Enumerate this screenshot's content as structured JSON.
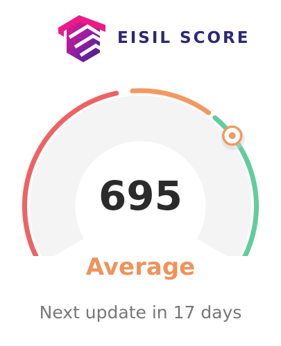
{
  "brand": {
    "name": "EISIL SCORE",
    "logo_icon": "layered-cube-logo-icon",
    "logo_gradient": [
      "#e5157d",
      "#5b1f9f",
      "#2c2778"
    ]
  },
  "gauge": {
    "score": 695,
    "min": 300,
    "max": 850,
    "rating": "Average",
    "marker_icon": "score-marker-icon",
    "colors": {
      "poor": "#ee6263",
      "average": "#f09a62",
      "good": "#62cc9c",
      "track": "#f4f4f4",
      "rating_text": "#ee935c"
    }
  },
  "next_update": "Next update in 17 days"
}
